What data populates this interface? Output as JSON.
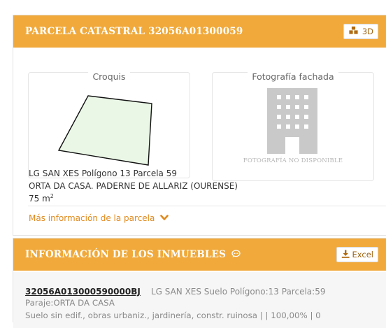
{
  "parcel": {
    "title": "PARCELA CATASTRAL 32056A01300059",
    "btn3d_label": "3D",
    "croquis_label": "Croquis",
    "photo_label": "Fotografía fachada",
    "photo_unavailable": "FOTOGRAFÍA NO DISPONIBLE",
    "location": "LG SAN XES Polígono 13 Parcela 59",
    "description": "ORTA DA CASA. PADERNE DE ALLARIZ (OURENSE)",
    "area_value": "75 m",
    "area_sup": "2",
    "more_info": "Más información de la parcela"
  },
  "buildings": {
    "title": "INFORMACIÓN DE LOS INMUEBLES",
    "excel_label": "Excel",
    "rows": [
      {
        "ref": "32056A013000590000BJ",
        "summary": "LG SAN XES Suelo Polígono:13 Parcela:59",
        "paraje": "Paraje:ORTA DA CASA",
        "usage": "Suelo sin edif., obras urbaniz., jardinería, constr. ruinosa | | 100,00% | 0"
      }
    ]
  },
  "colors": {
    "header_bg": "#f0a93a",
    "accent_link": "#e08a1e",
    "parcel_fill": "#eaf7e6"
  },
  "icons": {
    "cubes": "cubes-icon",
    "chevron": "chevron-down-icon",
    "comment": "comment-icon",
    "download": "download-icon",
    "building": "building-icon"
  }
}
